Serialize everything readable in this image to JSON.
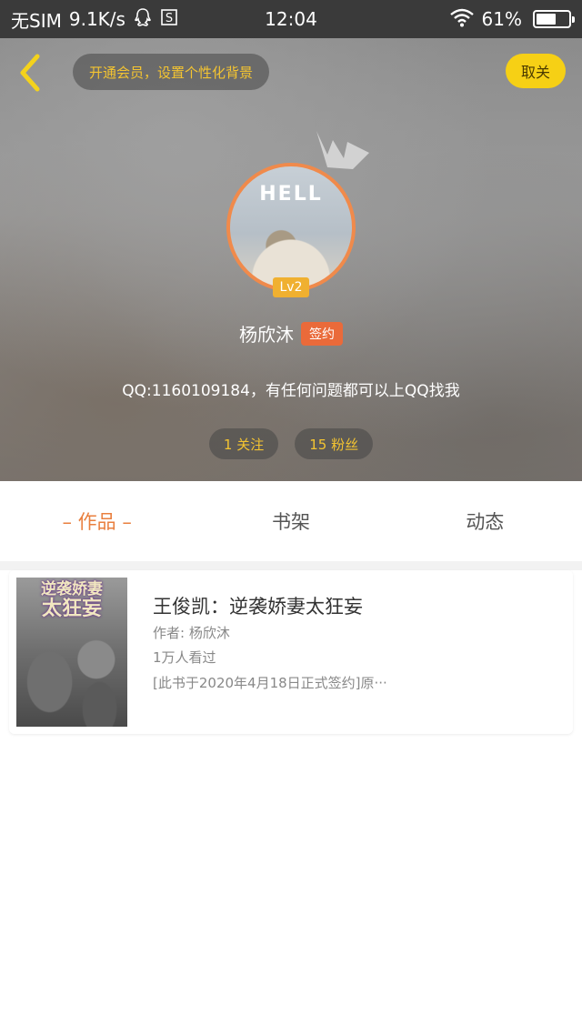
{
  "status_bar": {
    "carrier": "无SIM",
    "speed": "9.1K/s",
    "time": "12:04",
    "battery": "61%",
    "battery_level": 0.61
  },
  "header": {
    "member_prompt": "开通会员，设置个性化背景",
    "unfollow_label": "取关",
    "avatar_shirt_text": "HELL",
    "level": "Lv2",
    "user_name": "杨欣沐",
    "signed_badge": "签约",
    "bio": "QQ:1160109184，有任何问题都可以上QQ找我",
    "follow_count": "1 关注",
    "fans_count": "15 粉丝"
  },
  "tabs": [
    {
      "label": "– 作品 –",
      "active": true
    },
    {
      "label": "书架",
      "active": false
    },
    {
      "label": "动态",
      "active": false
    }
  ],
  "book": {
    "cover_line1": "逆袭娇妻",
    "cover_line2": "太狂妄",
    "title": "王俊凯：逆袭娇妻太狂妄",
    "author": "作者: 杨欣沐",
    "views": "1万人看过",
    "description": "[此书于2020年4月18日正式签约]原···"
  },
  "colors": {
    "accent_orange": "#e97f3e",
    "unfollow_yellow": "#f6d015",
    "badge_text_yellow": "#f4c431"
  }
}
